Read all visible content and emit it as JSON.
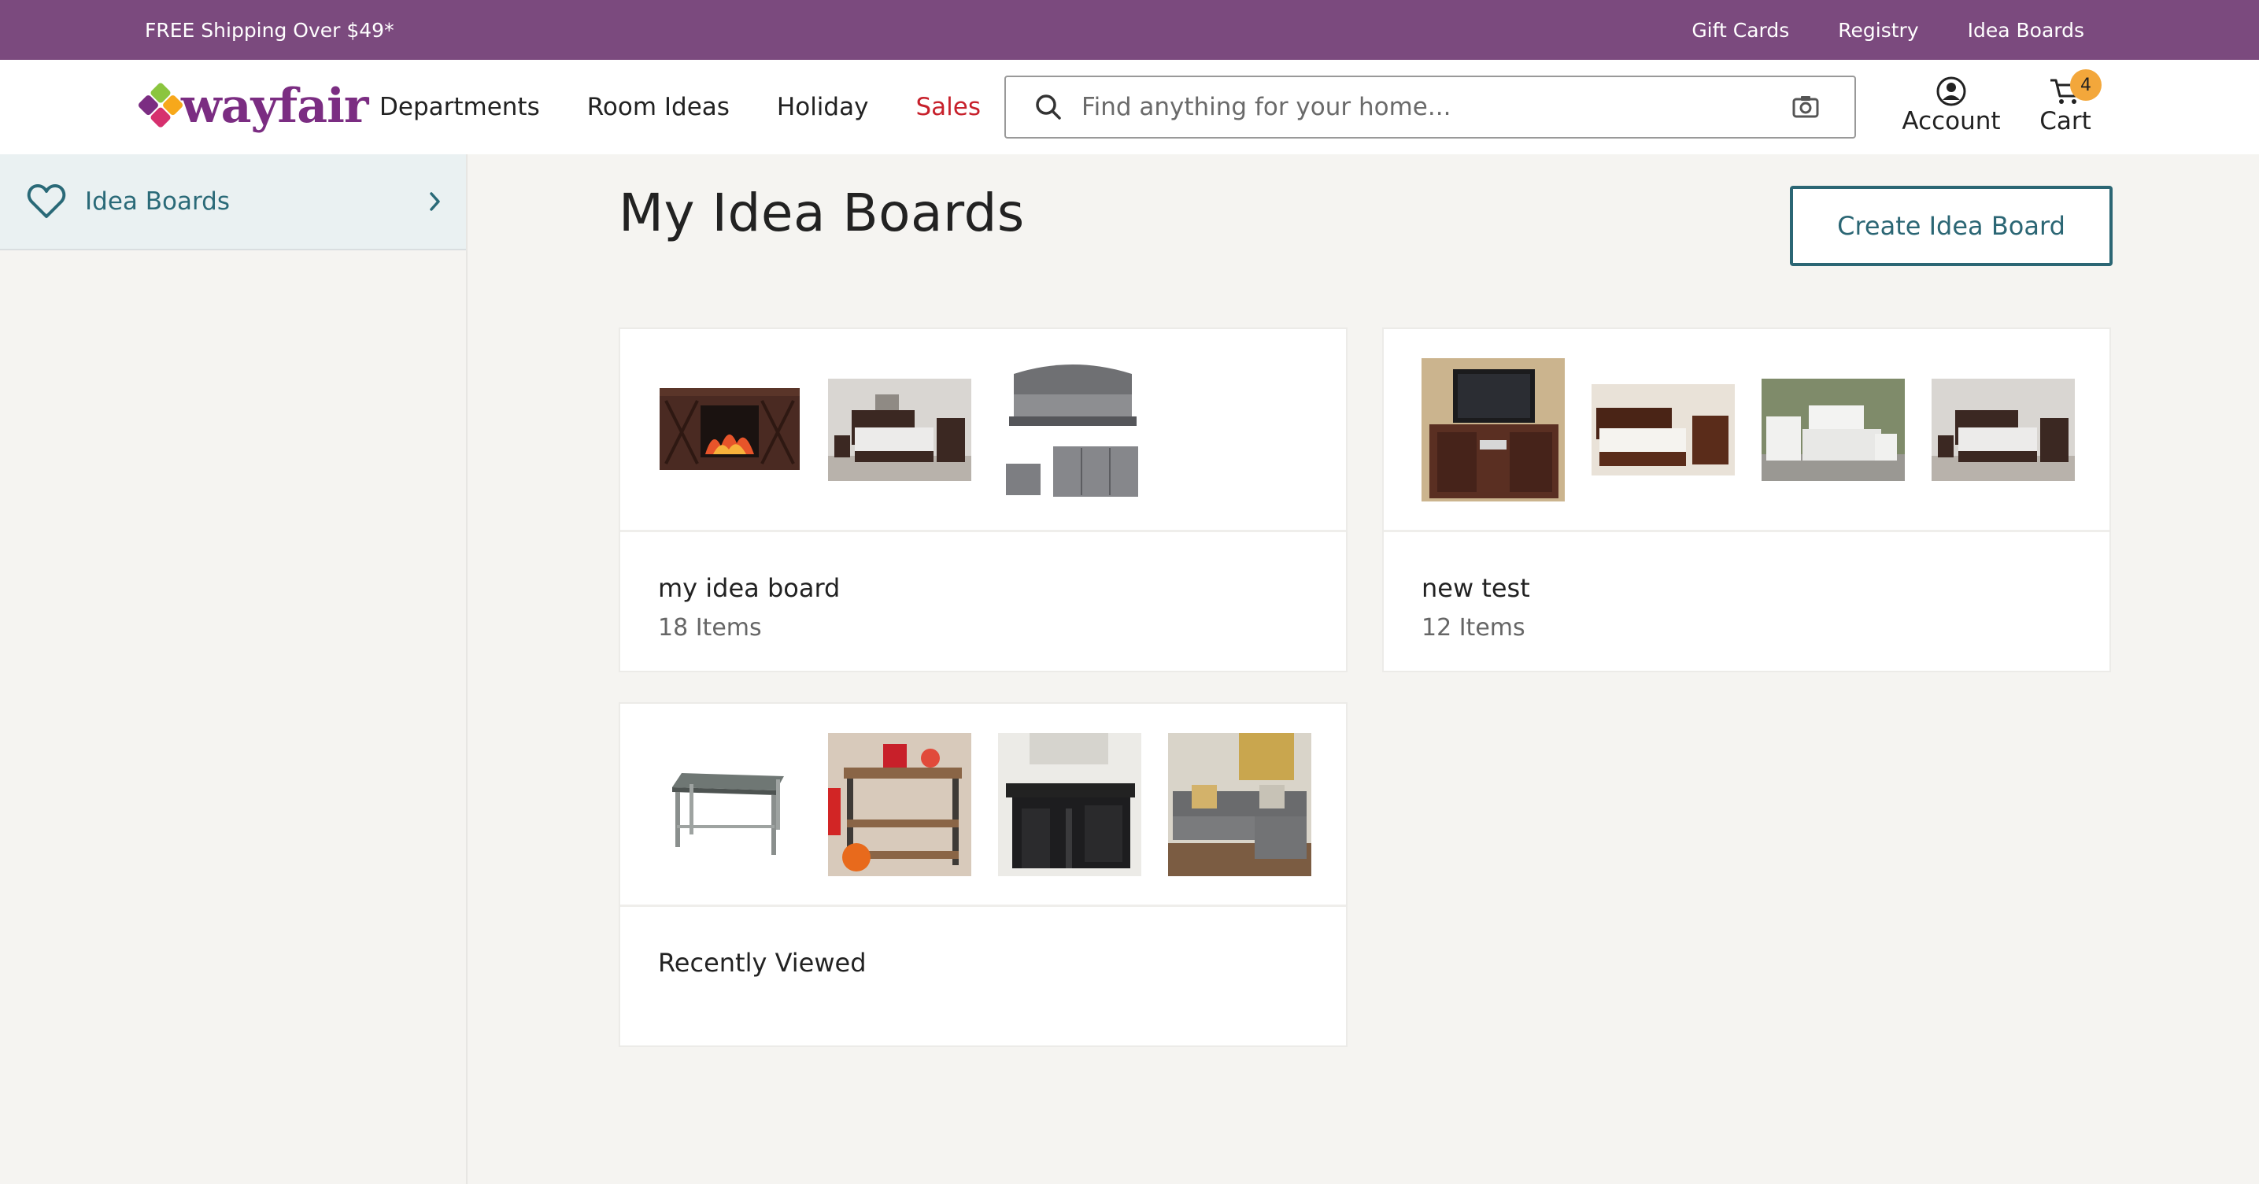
{
  "promo": {
    "text": "FREE Shipping Over $49*",
    "links": [
      "Gift Cards",
      "Registry",
      "Idea Boards"
    ]
  },
  "header": {
    "logo_text": "wayfair",
    "nav": [
      "Departments",
      "Room Ideas",
      "Holiday",
      "Sales"
    ],
    "search_placeholder": "Find anything for your home...",
    "account_label": "Account",
    "cart_label": "Cart",
    "cart_count": "4"
  },
  "sidebar": {
    "items": [
      {
        "label": "Idea Boards",
        "icon": "heart-icon"
      }
    ]
  },
  "main": {
    "title": "My Idea Boards",
    "create_button": "Create Idea Board",
    "boards": [
      {
        "name": "my idea board",
        "count": "18 Items",
        "thumbnails": [
          "tv-fireplace-console",
          "bedroom-set",
          "gray-tufted-bed-set"
        ]
      },
      {
        "name": "new test",
        "count": "12 Items",
        "thumbnails": [
          "tv-stand",
          "bedroom-storage-bed",
          "white-bedroom-set",
          "dark-bedroom-set"
        ]
      },
      {
        "name": "Recently Viewed",
        "count": "",
        "thumbnails": [
          "steel-work-table",
          "kitchen-cart",
          "black-kitchen-island",
          "gray-sectional-sofa"
        ]
      }
    ]
  },
  "colors": {
    "promo_bg": "#7b4a7e",
    "brand_purple": "#7b2d82",
    "sales_red": "#c7202b",
    "accent_teal": "#2b6674",
    "badge_orange": "#f3a73b",
    "page_bg": "#f5f4f1"
  }
}
